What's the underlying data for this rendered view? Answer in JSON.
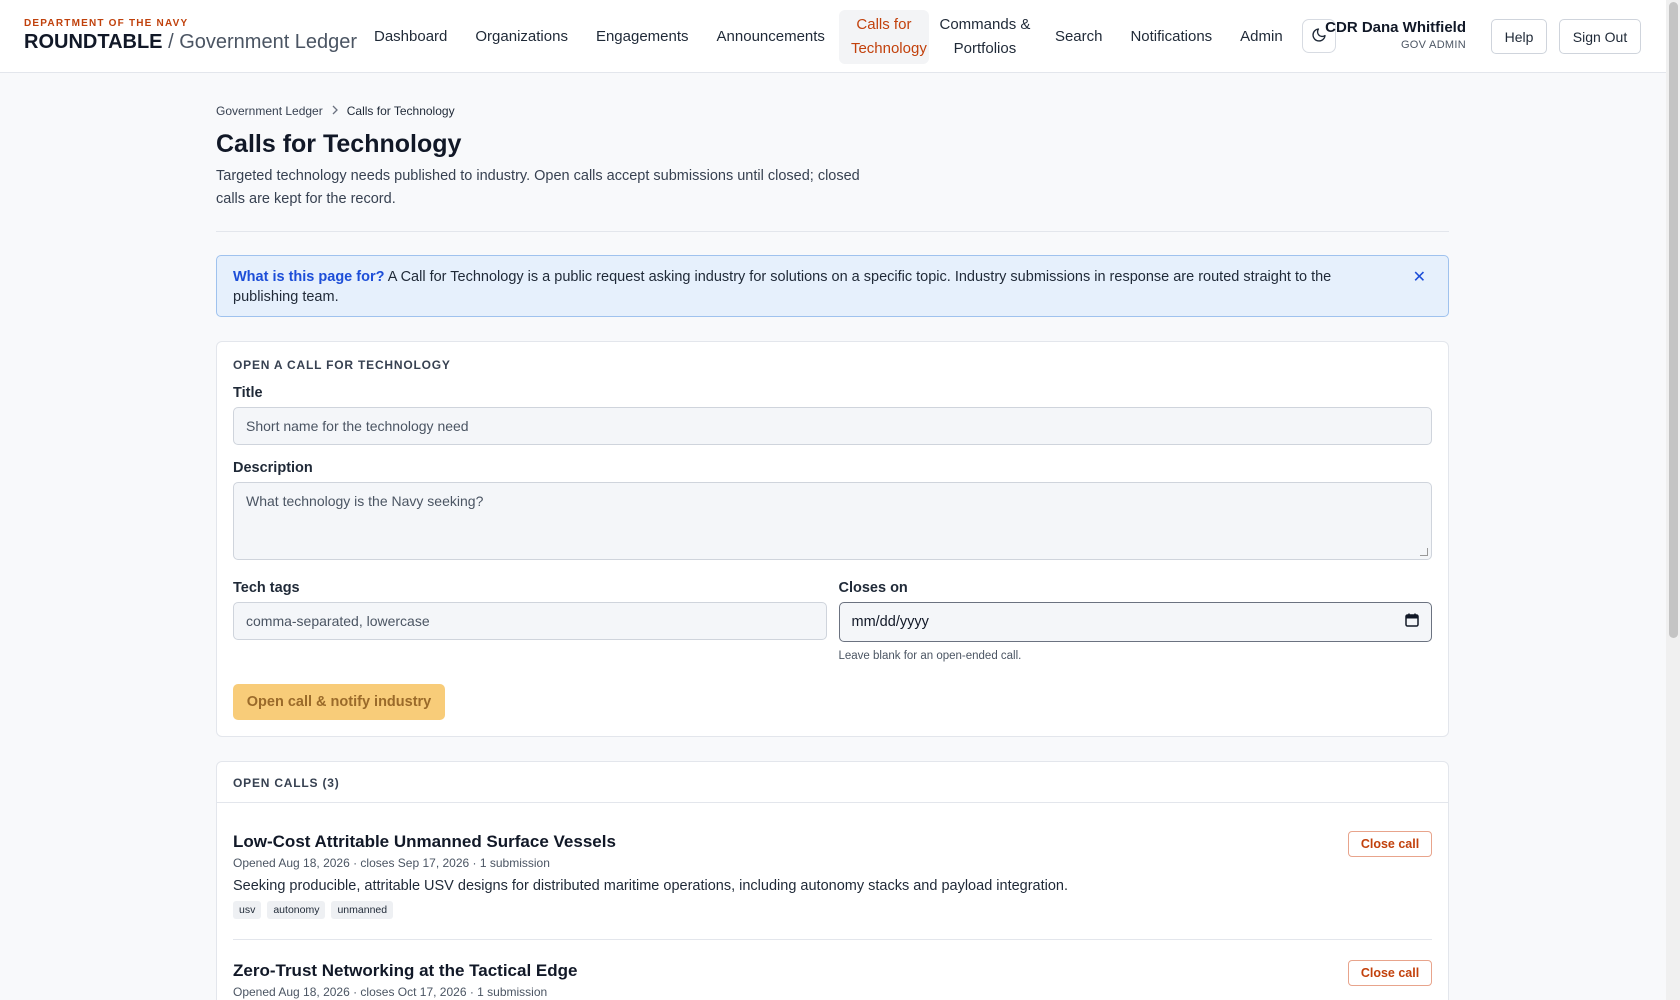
{
  "header": {
    "dept": "DEPARTMENT OF THE NAVY",
    "brand": "ROUNDTABLE",
    "separator": "/",
    "subtitle": "Government Ledger",
    "nav": [
      {
        "label": "Dashboard"
      },
      {
        "label": "Organizations"
      },
      {
        "label": "Engagements"
      },
      {
        "label": "Announcements"
      },
      {
        "label": "Calls for Technology",
        "active": true
      },
      {
        "label": "Commands & Portfolios"
      },
      {
        "label": "Search"
      },
      {
        "label": "Notifications"
      },
      {
        "label": "Admin"
      }
    ],
    "theme_icon": "moon-icon",
    "user_name": "CDR Dana Whitfield",
    "user_role": "GOV ADMIN",
    "help_label": "Help",
    "signout_label": "Sign Out"
  },
  "breadcrumb": {
    "root": "Government Ledger",
    "current": "Calls for Technology"
  },
  "page": {
    "title": "Calls for Technology",
    "description": "Targeted technology needs published to industry. Open calls accept submissions until closed; closed calls are kept for the record."
  },
  "info": {
    "question": "What is this page for?",
    "text": "A Call for Technology is a public request asking industry for solutions on a specific topic. Industry submissions in response are routed straight to the publishing team.",
    "close_glyph": "✕"
  },
  "form": {
    "section_title": "OPEN A CALL FOR TECHNOLOGY",
    "title_label": "Title",
    "title_placeholder": "Short name for the technology need",
    "description_label": "Description",
    "description_placeholder": "What technology is the Navy seeking?",
    "tags_label": "Tech tags",
    "tags_placeholder": "comma-separated, lowercase",
    "closes_label": "Closes on",
    "closes_placeholder": "mm/dd/yyyy",
    "closes_hint": "Leave blank for an open-ended call.",
    "submit_label": "Open call & notify industry"
  },
  "open_calls": {
    "heading": "OPEN CALLS (3)",
    "close_label": "Close call",
    "items": [
      {
        "title": "Low-Cost Attritable Unmanned Surface Vessels",
        "meta": "Opened Aug 18, 2026 · closes Sep 17, 2026 · 1 submission",
        "description": "Seeking producible, attritable USV designs for distributed maritime operations, including autonomy stacks and payload integration.",
        "tags": [
          "usv",
          "autonomy",
          "unmanned"
        ]
      },
      {
        "title": "Zero-Trust Networking at the Tactical Edge",
        "meta": "Opened Aug 18, 2026 · closes Oct 17, 2026 · 1 submission"
      }
    ]
  },
  "colors": {
    "accent": "#c2410c",
    "info_bg": "#e6f0fc",
    "info_link": "#1d4ed8",
    "primary_disabled": "#f8cc79"
  }
}
